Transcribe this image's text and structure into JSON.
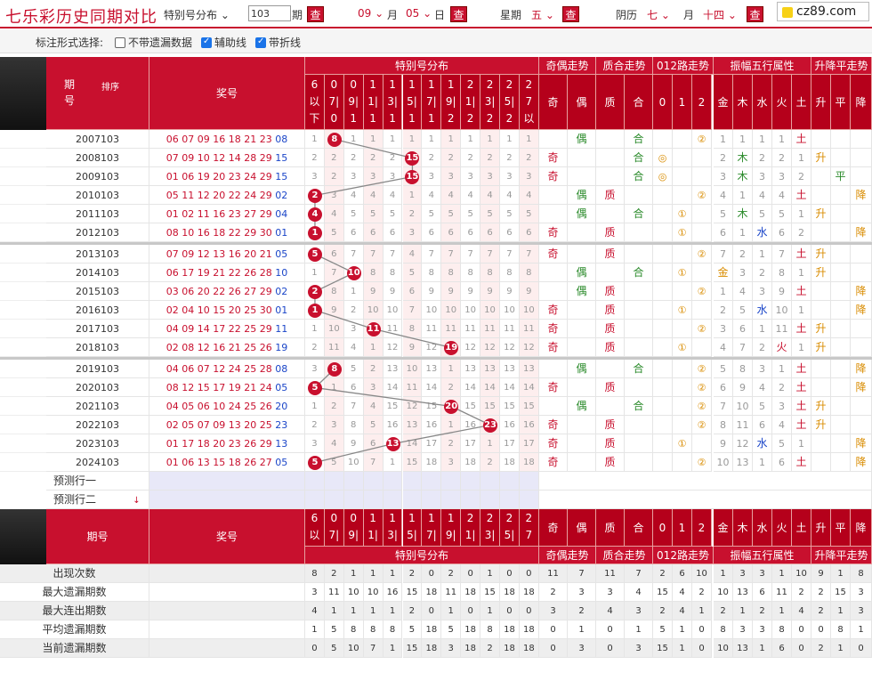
{
  "top": {
    "title": "七乐彩历史同期对比",
    "mode": "特别号分布",
    "period_value": "103",
    "period_label": "期",
    "query_label": "查",
    "month_sel": "09",
    "month_label": "月",
    "day_sel": "05",
    "day_label": "日",
    "week_label": "星期",
    "week_sel": "五",
    "lunar_label": "阴历",
    "lunar_month_sel": "七",
    "lunar_month_label": "月",
    "lunar_day_sel": "十四",
    "logo": "cz89.com"
  },
  "options": {
    "label": "标注形式选择:",
    "opt1": "不带遗漏数据",
    "opt1_checked": false,
    "opt2": "辅助线",
    "opt2_checked": true,
    "opt3": "带折线",
    "opt3_checked": true
  },
  "header": {
    "period": "期号",
    "sort": "排序",
    "award": "奖号",
    "special_dist": "特别号分布",
    "odd_even": "奇偶走势",
    "prime": "质合走势",
    "road012": "012路走势",
    "wuxing": "振幅五行属性",
    "updown": "升降平走势",
    "cols": [
      "6以下",
      "07|08",
      "09|10",
      "11|12",
      "13|14",
      "15|16",
      "17|18",
      "19|20",
      "21|22",
      "23|24",
      "25|26",
      "27以上"
    ],
    "oe": [
      "奇",
      "偶"
    ],
    "pc": [
      "质",
      "合"
    ],
    "r": [
      "0",
      "1",
      "2"
    ],
    "wx": [
      "金",
      "木",
      "水",
      "火",
      "土"
    ],
    "ud": [
      "升",
      "平",
      "降"
    ]
  },
  "rows": [
    {
      "period": "2007103",
      "nums": "06 07 09 16 18 21 23",
      "sp": "08",
      "ball": 1,
      "ballv": "8",
      "dist": [
        "1",
        "",
        "1",
        "1",
        "1",
        "1",
        "1",
        "1",
        "1",
        "1",
        "1",
        "1"
      ],
      "oe": "偶",
      "oecol": 1,
      "pc": "合",
      "pccol": 1,
      "r": "②",
      "rcol": 2,
      "wx": [
        "1",
        "1",
        "1",
        "1",
        "土"
      ],
      "ud": "",
      "udcol": -1
    },
    {
      "period": "2008103",
      "nums": "07 09 10 12 14 28 29",
      "sp": "15",
      "ball": 5,
      "ballv": "15",
      "dist": [
        "2",
        "2",
        "2",
        "2",
        "2",
        "",
        "2",
        "2",
        "2",
        "2",
        "2",
        "2"
      ],
      "oe": "奇",
      "oecol": 0,
      "pc": "合",
      "pccol": 1,
      "r": "◎",
      "rcol": 0,
      "wx": [
        "2",
        "木",
        "2",
        "2",
        "1"
      ],
      "ud": "升",
      "udcol": 0
    },
    {
      "period": "2009103",
      "nums": "01 06 19 20 23 24 29",
      "sp": "15",
      "ball": 5,
      "ballv": "15",
      "dist": [
        "3",
        "2",
        "3",
        "3",
        "3",
        "",
        "3",
        "3",
        "3",
        "3",
        "3",
        "3"
      ],
      "oe": "奇",
      "oecol": 0,
      "pc": "合",
      "pccol": 1,
      "r": "◎",
      "rcol": 0,
      "wx": [
        "3",
        "木",
        "3",
        "3",
        "2"
      ],
      "ud": "平",
      "udcol": 1
    },
    {
      "period": "2010103",
      "nums": "05 11 12 20 22 24 29",
      "sp": "02",
      "ball": 0,
      "ballv": "2",
      "dist": [
        "",
        "3",
        "4",
        "4",
        "4",
        "1",
        "4",
        "4",
        "4",
        "4",
        "4",
        "4"
      ],
      "oe": "偶",
      "oecol": 1,
      "pc": "质",
      "pccol": 0,
      "r": "②",
      "rcol": 2,
      "wx": [
        "4",
        "1",
        "4",
        "4",
        "土"
      ],
      "ud": "降",
      "udcol": 2
    },
    {
      "period": "2011103",
      "nums": "01 02 11 16 23 27 29",
      "sp": "04",
      "ball": 0,
      "ballv": "4",
      "dist": [
        "",
        "4",
        "5",
        "5",
        "5",
        "2",
        "5",
        "5",
        "5",
        "5",
        "5",
        "5"
      ],
      "oe": "偶",
      "oecol": 1,
      "pc": "合",
      "pccol": 1,
      "r": "①",
      "rcol": 1,
      "wx": [
        "5",
        "木",
        "5",
        "5",
        "1"
      ],
      "ud": "升",
      "udcol": 0
    },
    {
      "period": "2012103",
      "nums": "08 10 16 18 22 29 30",
      "sp": "01",
      "ball": 0,
      "ballv": "1",
      "dist": [
        "",
        "5",
        "6",
        "6",
        "6",
        "3",
        "6",
        "6",
        "6",
        "6",
        "6",
        "6"
      ],
      "oe": "奇",
      "oecol": 0,
      "pc": "质",
      "pccol": 0,
      "r": "①",
      "rcol": 1,
      "wx": [
        "6",
        "1",
        "水",
        "6",
        "2"
      ],
      "ud": "降",
      "udcol": 2
    },
    {
      "period": "2013103",
      "nums": "07 09 12 13 16 20 21",
      "sp": "05",
      "ball": 0,
      "ballv": "5",
      "dist": [
        "",
        "6",
        "7",
        "7",
        "7",
        "4",
        "7",
        "7",
        "7",
        "7",
        "7",
        "7"
      ],
      "oe": "奇",
      "oecol": 0,
      "pc": "质",
      "pccol": 0,
      "r": "②",
      "rcol": 2,
      "wx": [
        "7",
        "2",
        "1",
        "7",
        "土"
      ],
      "ud": "升",
      "udcol": 0
    },
    {
      "period": "2014103",
      "nums": "06 17 19 21 22 26 28",
      "sp": "10",
      "ball": 2,
      "ballv": "10",
      "dist": [
        "1",
        "7",
        "",
        "8",
        "8",
        "5",
        "8",
        "8",
        "8",
        "8",
        "8",
        "8"
      ],
      "oe": "偶",
      "oecol": 1,
      "pc": "合",
      "pccol": 1,
      "r": "①",
      "rcol": 1,
      "wx": [
        "金",
        "3",
        "2",
        "8",
        "1"
      ],
      "ud": "升",
      "udcol": 0
    },
    {
      "period": "2015103",
      "nums": "03 06 20 22 26 27 29",
      "sp": "02",
      "ball": 0,
      "ballv": "2",
      "dist": [
        "",
        "8",
        "1",
        "9",
        "9",
        "6",
        "9",
        "9",
        "9",
        "9",
        "9",
        "9"
      ],
      "oe": "偶",
      "oecol": 1,
      "pc": "质",
      "pccol": 0,
      "r": "②",
      "rcol": 2,
      "wx": [
        "1",
        "4",
        "3",
        "9",
        "土"
      ],
      "ud": "降",
      "udcol": 2
    },
    {
      "period": "2016103",
      "nums": "02 04 10 15 20 25 30",
      "sp": "01",
      "ball": 0,
      "ballv": "1",
      "dist": [
        "",
        "9",
        "2",
        "10",
        "10",
        "7",
        "10",
        "10",
        "10",
        "10",
        "10",
        "10"
      ],
      "oe": "奇",
      "oecol": 0,
      "pc": "质",
      "pccol": 0,
      "r": "①",
      "rcol": 1,
      "wx": [
        "2",
        "5",
        "水",
        "10",
        "1"
      ],
      "ud": "降",
      "udcol": 2
    },
    {
      "period": "2017103",
      "nums": "04 09 14 17 22 25 29",
      "sp": "11",
      "ball": 3,
      "ballv": "11",
      "dist": [
        "1",
        "10",
        "3",
        "",
        "11",
        "8",
        "11",
        "11",
        "11",
        "11",
        "11",
        "11"
      ],
      "oe": "奇",
      "oecol": 0,
      "pc": "质",
      "pccol": 0,
      "r": "②",
      "rcol": 2,
      "wx": [
        "3",
        "6",
        "1",
        "11",
        "土"
      ],
      "ud": "升",
      "udcol": 0
    },
    {
      "period": "2018103",
      "nums": "02 08 12 16 21 25 26",
      "sp": "19",
      "ball": 7,
      "ballv": "19",
      "dist": [
        "2",
        "11",
        "4",
        "1",
        "12",
        "9",
        "12",
        "",
        "12",
        "12",
        "12",
        "12"
      ],
      "oe": "奇",
      "oecol": 0,
      "pc": "质",
      "pccol": 0,
      "r": "①",
      "rcol": 1,
      "wx": [
        "4",
        "7",
        "2",
        "火",
        "1"
      ],
      "ud": "升",
      "udcol": 0
    },
    {
      "period": "2019103",
      "nums": "04 06 07 12 24 25 28",
      "sp": "08",
      "ball": 1,
      "ballv": "8",
      "dist": [
        "3",
        "",
        "5",
        "2",
        "13",
        "10",
        "13",
        "1",
        "13",
        "13",
        "13",
        "13"
      ],
      "oe": "偶",
      "oecol": 1,
      "pc": "合",
      "pccol": 1,
      "r": "②",
      "rcol": 2,
      "wx": [
        "5",
        "8",
        "3",
        "1",
        "土"
      ],
      "ud": "降",
      "udcol": 2
    },
    {
      "period": "2020103",
      "nums": "08 12 15 17 19 21 24",
      "sp": "05",
      "ball": 0,
      "ballv": "5",
      "dist": [
        "",
        "1",
        "6",
        "3",
        "14",
        "11",
        "14",
        "2",
        "14",
        "14",
        "14",
        "14"
      ],
      "oe": "奇",
      "oecol": 0,
      "pc": "质",
      "pccol": 0,
      "r": "②",
      "rcol": 2,
      "wx": [
        "6",
        "9",
        "4",
        "2",
        "土"
      ],
      "ud": "降",
      "udcol": 2
    },
    {
      "period": "2021103",
      "nums": "04 05 06 10 24 25 26",
      "sp": "20",
      "ball": 7,
      "ballv": "20",
      "dist": [
        "1",
        "2",
        "7",
        "4",
        "15",
        "12",
        "15",
        "",
        "15",
        "15",
        "15",
        "15"
      ],
      "oe": "偶",
      "oecol": 1,
      "pc": "合",
      "pccol": 1,
      "r": "②",
      "rcol": 2,
      "wx": [
        "7",
        "10",
        "5",
        "3",
        "土"
      ],
      "ud": "升",
      "udcol": 0
    },
    {
      "period": "2022103",
      "nums": "02 05 07 09 13 20 25",
      "sp": "23",
      "ball": 9,
      "ballv": "23",
      "dist": [
        "2",
        "3",
        "8",
        "5",
        "16",
        "13",
        "16",
        "1",
        "16",
        "",
        "16",
        "16"
      ],
      "oe": "奇",
      "oecol": 0,
      "pc": "质",
      "pccol": 0,
      "r": "②",
      "rcol": 2,
      "wx": [
        "8",
        "11",
        "6",
        "4",
        "土"
      ],
      "ud": "升",
      "udcol": 0
    },
    {
      "period": "2023103",
      "nums": "01 17 18 20 23 26 29",
      "sp": "13",
      "ball": 4,
      "ballv": "13",
      "dist": [
        "3",
        "4",
        "9",
        "6",
        "",
        "14",
        "17",
        "2",
        "17",
        "1",
        "17",
        "17"
      ],
      "oe": "奇",
      "oecol": 0,
      "pc": "质",
      "pccol": 0,
      "r": "①",
      "rcol": 1,
      "wx": [
        "9",
        "12",
        "水",
        "5",
        "1"
      ],
      "ud": "降",
      "udcol": 2
    },
    {
      "period": "2024103",
      "nums": "01 06 13 15 18 26 27",
      "sp": "05",
      "ball": 0,
      "ballv": "5",
      "dist": [
        "",
        "5",
        "10",
        "7",
        "1",
        "15",
        "18",
        "3",
        "18",
        "2",
        "18",
        "18"
      ],
      "oe": "奇",
      "oecol": 0,
      "pc": "质",
      "pccol": 0,
      "r": "②",
      "rcol": 2,
      "wx": [
        "10",
        "13",
        "1",
        "6",
        "土"
      ],
      "ud": "降",
      "udcol": 2
    }
  ],
  "predict": [
    "预测行一",
    "预测行二"
  ],
  "stats": [
    {
      "label": "出现次数",
      "v": [
        "8",
        "2",
        "1",
        "1",
        "1",
        "2",
        "0",
        "2",
        "0",
        "1",
        "0",
        "0",
        "11",
        "7",
        "11",
        "7",
        "2",
        "6",
        "10",
        "1",
        "3",
        "3",
        "1",
        "10",
        "9",
        "1",
        "8"
      ]
    },
    {
      "label": "最大遗漏期数",
      "v": [
        "3",
        "11",
        "10",
        "10",
        "16",
        "15",
        "18",
        "11",
        "18",
        "15",
        "18",
        "18",
        "2",
        "3",
        "3",
        "4",
        "15",
        "4",
        "2",
        "10",
        "13",
        "6",
        "11",
        "2",
        "2",
        "15",
        "3"
      ]
    },
    {
      "label": "最大连出期数",
      "v": [
        "4",
        "1",
        "1",
        "1",
        "1",
        "2",
        "0",
        "1",
        "0",
        "1",
        "0",
        "0",
        "3",
        "2",
        "4",
        "3",
        "2",
        "4",
        "1",
        "2",
        "1",
        "2",
        "1",
        "4",
        "2",
        "1",
        "3"
      ]
    },
    {
      "label": "平均遗漏期数",
      "v": [
        "1",
        "5",
        "8",
        "8",
        "8",
        "5",
        "18",
        "5",
        "18",
        "8",
        "18",
        "18",
        "0",
        "1",
        "0",
        "1",
        "5",
        "1",
        "0",
        "8",
        "3",
        "3",
        "8",
        "0",
        "0",
        "8",
        "1"
      ]
    },
    {
      "label": "当前遗漏期数",
      "v": [
        "0",
        "5",
        "10",
        "7",
        "1",
        "15",
        "18",
        "3",
        "18",
        "2",
        "18",
        "18",
        "0",
        "3",
        "0",
        "3",
        "15",
        "1",
        "0",
        "10",
        "13",
        "1",
        "6",
        "0",
        "2",
        "1",
        "0"
      ]
    }
  ]
}
